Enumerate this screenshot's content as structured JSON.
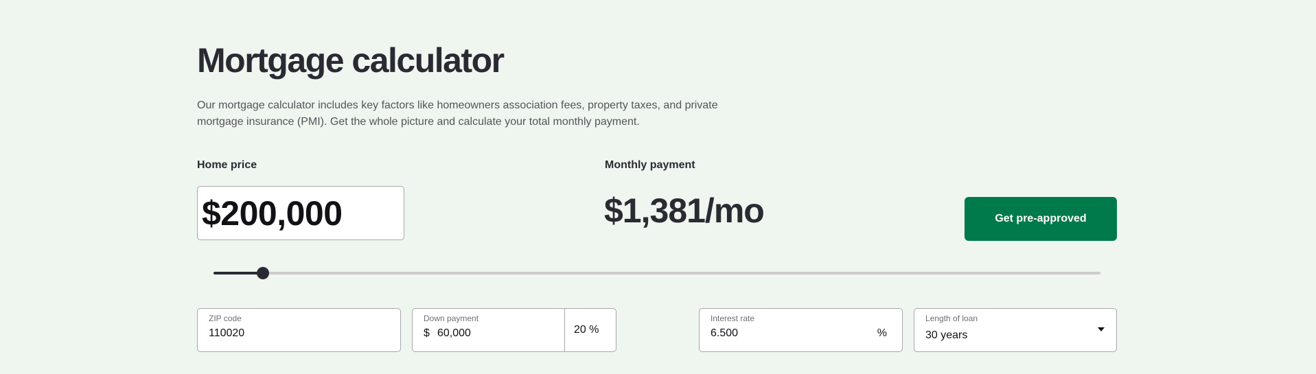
{
  "page": {
    "title": "Mortgage calculator",
    "description": "Our mortgage calculator includes key factors like homeowners association fees, property taxes, and private mortgage insurance (PMI). Get the whole picture and calculate your total monthly payment."
  },
  "home_price": {
    "label": "Home price",
    "value": "$200,000",
    "slider_fraction": 0.056
  },
  "monthly_payment": {
    "label": "Monthly payment",
    "value": "$1,381/mo"
  },
  "cta": {
    "label": "Get pre-approved"
  },
  "fields": {
    "zip": {
      "label": "ZIP code",
      "value": "110020"
    },
    "down_payment": {
      "label": "Down payment",
      "currency": "$",
      "amount": "60,000",
      "percent": "20 %"
    },
    "interest_rate": {
      "label": "Interest rate",
      "value": "6.500",
      "unit": "%"
    },
    "loan_length": {
      "label": "Length of loan",
      "value": "30 years"
    }
  },
  "colors": {
    "background": "#eff6ef",
    "accent": "#007a4b",
    "text": "#2a2a33"
  }
}
